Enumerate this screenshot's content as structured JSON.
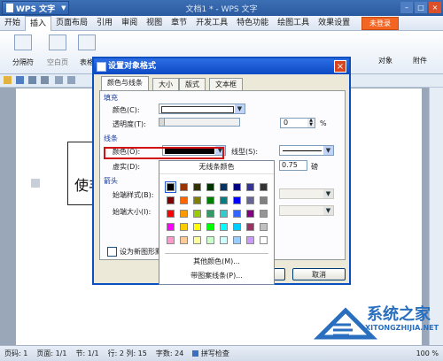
{
  "app": {
    "wps_button": "WPS 文字",
    "title": "文档1 * - WPS 文字"
  },
  "menu": {
    "items": [
      "开始",
      "插入",
      "页面布局",
      "引用",
      "审阅",
      "视图",
      "章节",
      "开发工具",
      "特色功能",
      "绘图工具",
      "效果设置"
    ],
    "login": "未登录"
  },
  "ribbon": {
    "page_break": "分隔符",
    "blank_page": "空白页",
    "table": "表格",
    "object": "对象",
    "attachment": "附件"
  },
  "document": {
    "text": "使丰"
  },
  "dialog": {
    "title": "设置对象格式",
    "tabs": [
      "颜色与线条",
      "大小",
      "版式",
      "文本框"
    ],
    "fill_section": "填充",
    "fill_color_label": "颜色(C):",
    "transparency_label": "透明度(T):",
    "transparency_value": "0",
    "transparency_unit": "%",
    "line_section": "线条",
    "line_color_label": "颜色(O):",
    "line_type_label": "线型(S):",
    "dash_label": "虚实(D):",
    "weight_label": "磅",
    "weight_value": "0.75",
    "arrow_section": "箭头",
    "begin_style_label": "始端样式(B):",
    "begin_size_label": "始端大小(I):",
    "default_checkbox_label": "设为新图形默",
    "cancel_button": "取消",
    "line_color_value": "#000000"
  },
  "color_popup": {
    "no_line": "无线条颜色",
    "more_colors": "其他颜色(M)...",
    "pattern_line": "带图案线条(P)...",
    "colors": [
      [
        "#000000",
        "#993300",
        "#333300",
        "#003300",
        "#003366",
        "#000080",
        "#333399",
        "#333333"
      ],
      [
        "#800000",
        "#ff6600",
        "#808000",
        "#008000",
        "#008080",
        "#0000ff",
        "#666699",
        "#808080"
      ],
      [
        "#ff0000",
        "#ff9900",
        "#99cc00",
        "#339966",
        "#33cccc",
        "#3366ff",
        "#800080",
        "#969696"
      ],
      [
        "#ff00ff",
        "#ffcc00",
        "#ffff00",
        "#00ff00",
        "#00ffff",
        "#00ccff",
        "#993366",
        "#c0c0c0"
      ],
      [
        "#ff99cc",
        "#ffcc99",
        "#ffff99",
        "#ccffcc",
        "#ccffff",
        "#99ccff",
        "#cc99ff",
        "#ffffff"
      ]
    ]
  },
  "status": {
    "page": "页码: 1",
    "pages": "页面: 1/1",
    "section": "节: 1/1",
    "position": "行: 2  列: 15",
    "words": "字数: 24",
    "spell": "拼写检查",
    "zoom": "100 %"
  },
  "watermark": {
    "name": "系统之家",
    "url": "XITONGZHIJIA.NET"
  }
}
